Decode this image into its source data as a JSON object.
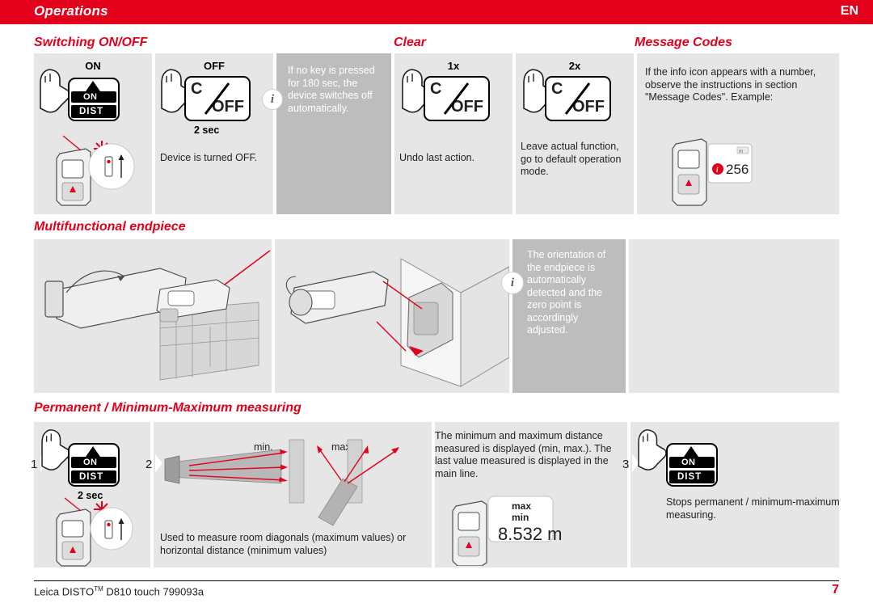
{
  "header": {
    "title": "Operations",
    "language": "EN"
  },
  "sections": {
    "switching": {
      "heading": "Switching ON/OFF",
      "on_label": "ON",
      "off_label": "OFF",
      "c_label": "C",
      "off_key_label": "OFF",
      "on_key_label": "ON",
      "dist_key_label": "DIST",
      "hold_label": "2 sec",
      "note_auto": "If no key is pressed for 180 sec, the device switches off automatically.",
      "note_off": "Device is turned OFF.",
      "info_icon": "info-icon"
    },
    "clear": {
      "heading": "Clear",
      "press_1x": "1x",
      "press_2x": "2x",
      "c_label": "C",
      "off_label": "OFF",
      "note_undo": "Undo last action.",
      "note_default": "Leave actual function, go to default operation mode."
    },
    "message_codes": {
      "heading": "Message Codes",
      "note": "If the info icon appears with a number, observe the instructions in section \"Message Codes\". Example:",
      "display_code": "256",
      "display_corner": "m"
    },
    "endpiece": {
      "heading": "Multifunctional endpiece",
      "note": "The orientation of the endpiece is automatically detected and the zero point is accordingly adjusted."
    },
    "permanent": {
      "heading": "Permanent / Minimum-Maximum measuring",
      "step1": "1",
      "step2": "2",
      "step3": "3",
      "on_key_label": "ON",
      "dist_key_label": "DIST",
      "hold_label": "2 sec",
      "min_label": "min.",
      "max_label": "max.",
      "note_measure": "The minimum and maximum distance measured is displayed (min, max.). The last value measured is displayed in the main line.",
      "note_used": "Used to measure room diagonals (maximum values) or horizontal distance (minimum values)",
      "note_stop": "Stops permanent / minimum-maximum measuring.",
      "display_max": "max",
      "display_min": "min",
      "display_value": "8.532 m",
      "on_key_label_3": "ON",
      "dist_key_label_3": "DIST"
    }
  },
  "footer": {
    "text_left": "Leica DISTO",
    "text_sup": "TM",
    "text_left2": " D810 touch  799093a",
    "page": "7"
  },
  "colors": {
    "brand_red": "#e2001a",
    "panel_grey": "#e6e6e6",
    "panel_dark": "#bdbdbd",
    "laser_red": "#e2001a"
  }
}
